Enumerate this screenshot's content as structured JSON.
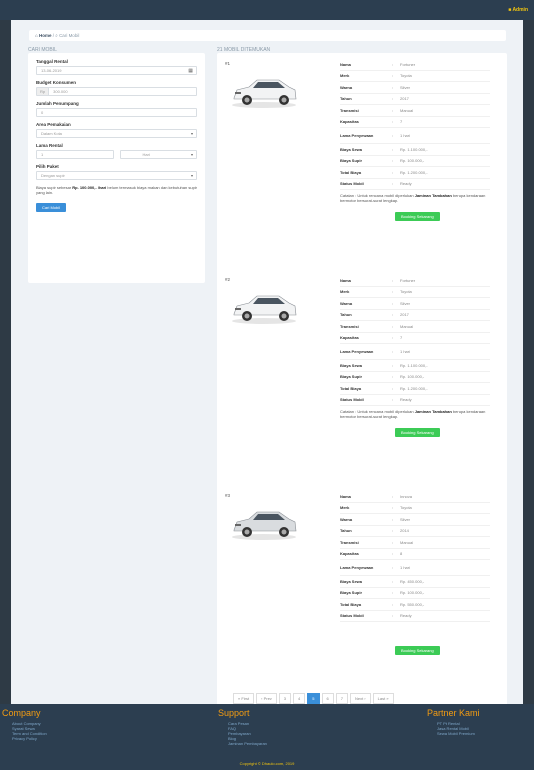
{
  "topbar": {
    "user_label": "■ Admin"
  },
  "breadcrumb": {
    "home": "Home",
    "current": "Cari Mobil"
  },
  "sidebar": {
    "title": "CARI MOBIL",
    "date_label": "Tanggal Rental",
    "date_value": "13-06-2019",
    "budget_label": "Budget Konsumen",
    "budget_prefix": "Rp",
    "budget_placeholder": "300.000",
    "passenger_label": "Jumlah Penumpang",
    "passenger_value": "0",
    "area_label": "Area Pemakaian",
    "area_value": "Dalam Kota",
    "duration_label": "Lama Rental",
    "duration_value": "1",
    "duration_unit": "Hari",
    "driver_label": "Pilih Paket",
    "driver_value": "Dengan supir",
    "note_prefix": "Biaya supir sebesar",
    "note_amount": "Rp. 100.000,- /hari",
    "note_suffix": "belum termasuk biaya makan dan kebutuhan supir yang lain.",
    "search_button": "Cari Mobil"
  },
  "results": {
    "title": "21 MOBIL DITEMUKAN",
    "spec_keys": [
      "Nama",
      "Merk",
      "Warna",
      "Tahun",
      "Transmisi",
      "Kapasitas",
      "Lama Penyewaan",
      "Biaya Sewa",
      "Biaya Supir",
      "Total Biaya",
      "Status Mobil"
    ],
    "colon": ":",
    "caption_prefix": "Catatan : Untuk rencana mobil diperlukan",
    "caption_bold": "Jaminan Tambahan",
    "caption_suffix": "berupa kendaraan bermotor bersurat-surat lengkap.",
    "book_button": "Booking Sekarang",
    "cars": [
      {
        "num": "#1",
        "values": [
          "Fortuner",
          "Toyota",
          "Silver",
          "2017",
          "Manual",
          "7",
          "1 hari",
          "Rp. 1.100.000,-",
          "Rp. 100.000,-",
          "Rp. 1.200.000,-",
          "Ready"
        ]
      },
      {
        "num": "#2",
        "values": [
          "Fortuner",
          "Toyota",
          "Silver",
          "2017",
          "Manual",
          "7",
          "1 hari",
          "Rp. 1.100.000,-",
          "Rp. 100.000,-",
          "Rp. 1.200.000,-",
          "Ready"
        ]
      },
      {
        "num": "#3",
        "values": [
          "Innova",
          "Toyota",
          "Silver",
          "2014",
          "Manual",
          "8",
          "1 hari",
          "Rp. 450.000,-",
          "Rp. 100.000,-",
          "Rp. 550.000,-",
          "Ready"
        ]
      }
    ]
  },
  "pager": [
    "« First",
    "‹ Prev",
    "3",
    "4",
    "5",
    "6",
    "7",
    "Next ›",
    "Last »"
  ],
  "pager_active": "5",
  "footer": {
    "company_title": "Company",
    "company_links": [
      "About Company",
      "Syarat Sewa",
      "Term and Condition",
      "Privacy Policy"
    ],
    "support_title": "Support",
    "support_links": [
      "Cara Pesan",
      "FAQ",
      "Pembayaran",
      "Blog",
      "Jaminan Pembayaran"
    ],
    "partner_title": "Partner Kami",
    "partner_links": [
      "PT Pt Rental",
      "Jasa Rental Mobil",
      "Sewa Mobil Premium"
    ],
    "copyright": "Copyright © Dhaulo.com, 2019"
  }
}
